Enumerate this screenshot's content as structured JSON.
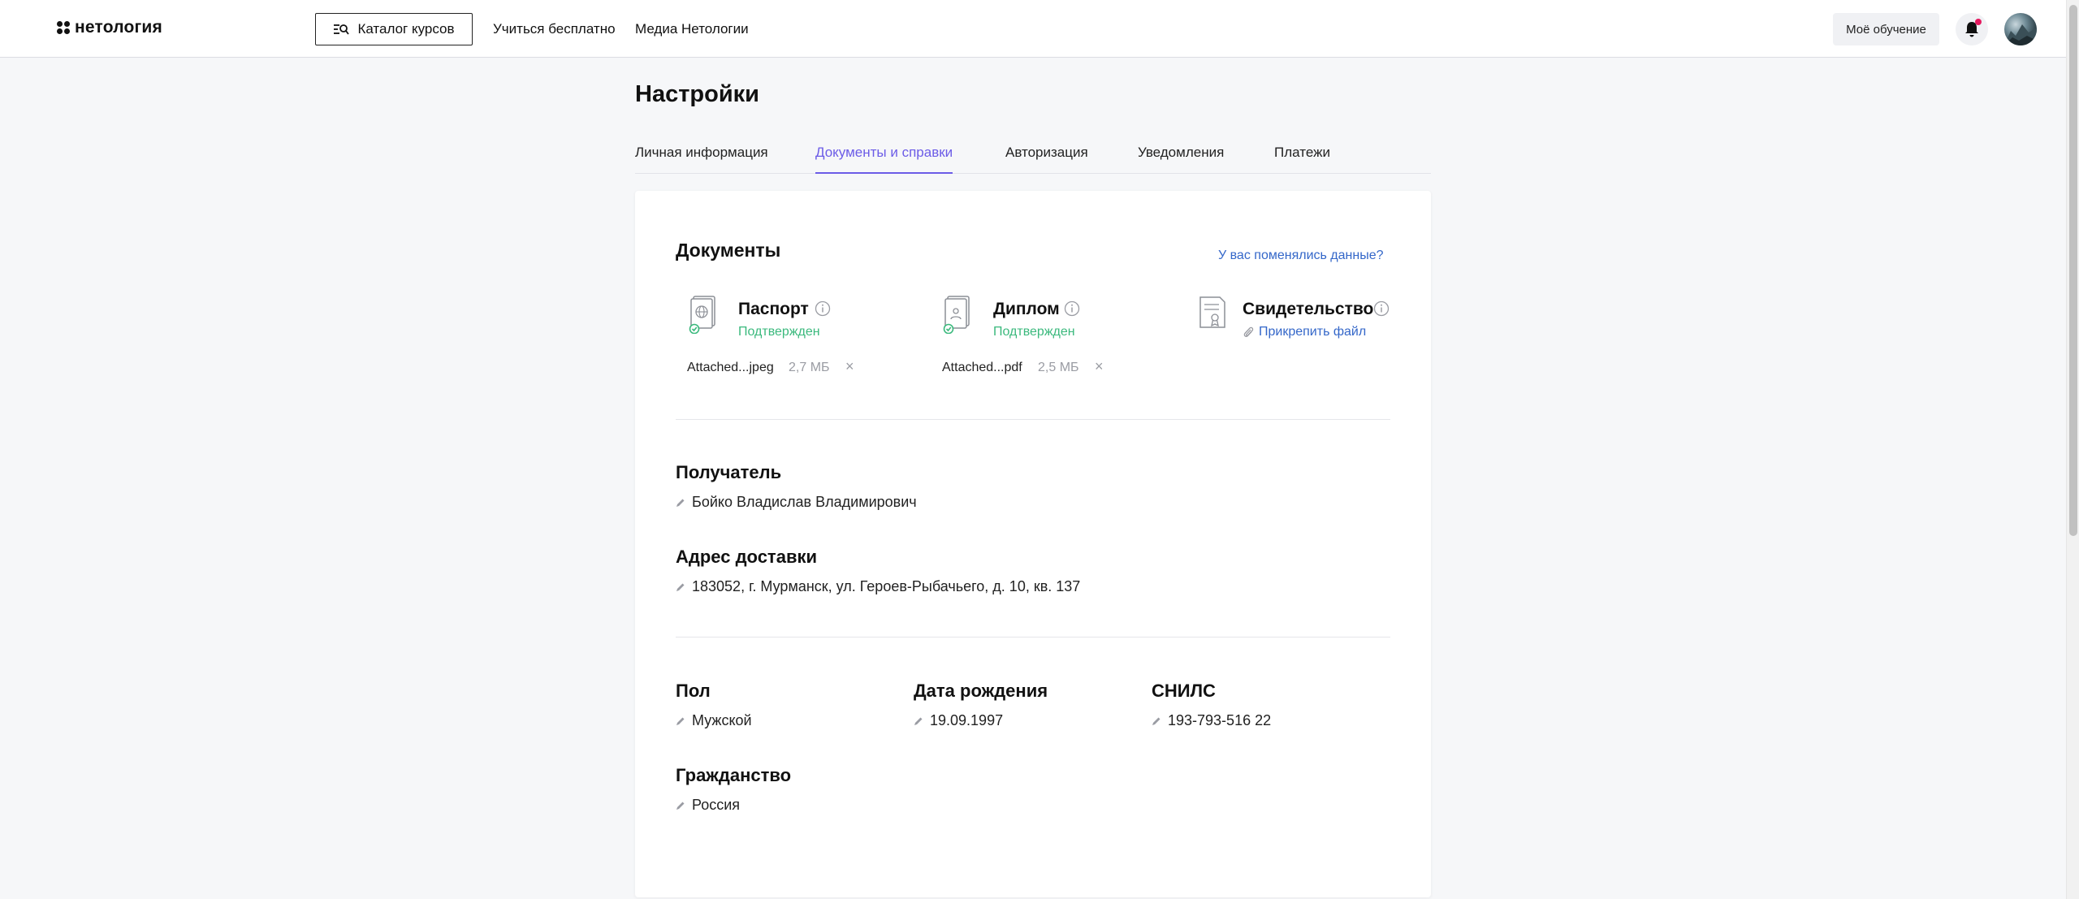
{
  "header": {
    "logo_text": "нетология",
    "catalog_label": "Каталог курсов",
    "nav": [
      "Учиться бесплатно",
      "Медиа Нетологии"
    ],
    "my_learning_label": "Моё обучение"
  },
  "page": {
    "title": "Настройки",
    "tabs": [
      {
        "label": "Личная информация",
        "active": false
      },
      {
        "label": "Документы и справки",
        "active": true
      },
      {
        "label": "Авторизация",
        "active": false
      },
      {
        "label": "Уведомления",
        "active": false
      },
      {
        "label": "Платежи",
        "active": false
      }
    ]
  },
  "documents": {
    "title": "Документы",
    "changed_link": "У вас поменялись данные?",
    "items": [
      {
        "name": "Паспорт",
        "status": "Подтвержден",
        "file_name": "Attached...jpeg",
        "file_size": "2,7 МБ"
      },
      {
        "name": "Диплом",
        "status": "Подтвержден",
        "file_name": "Attached...pdf",
        "file_size": "2,5 МБ"
      },
      {
        "name": "Свидетельство",
        "attach_label": "Прикрепить файл"
      }
    ]
  },
  "recipient": {
    "title": "Получатель",
    "value": "Бойко Владислав Владимирович"
  },
  "address": {
    "title": "Адрес доставки",
    "value": "183052, г. Мурманск, ул. Героев-Рыбачьего, д. 10, кв. 137"
  },
  "gender": {
    "title": "Пол",
    "value": "Мужской"
  },
  "birthdate": {
    "title": "Дата рождения",
    "value": "19.09.1997"
  },
  "snils": {
    "title": "СНИЛС",
    "value": "193-793-516 22"
  },
  "citizenship": {
    "title": "Гражданство",
    "value": "Россия"
  },
  "colors": {
    "accent": "#6c5ce7",
    "link": "#3467c9",
    "success": "#3bb97d",
    "notification": "#e5195e"
  }
}
